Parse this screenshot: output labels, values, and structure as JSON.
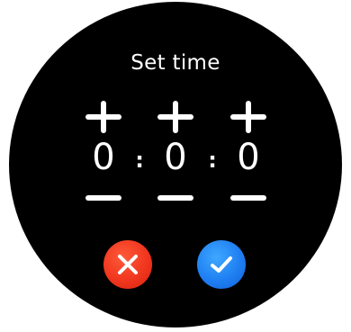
{
  "screen": {
    "title": "Set time"
  },
  "time_picker": {
    "separator": ":",
    "fields": [
      {
        "value": "0"
      },
      {
        "value": "0"
      },
      {
        "value": "0"
      }
    ]
  },
  "icons": {
    "increment": "plus-icon",
    "decrement": "minus-icon",
    "cancel": "close-icon",
    "confirm": "check-icon"
  },
  "colors": {
    "background": "#000000",
    "text": "#ffffff",
    "cancel": "#f0361e",
    "confirm": "#1f7ff2"
  }
}
